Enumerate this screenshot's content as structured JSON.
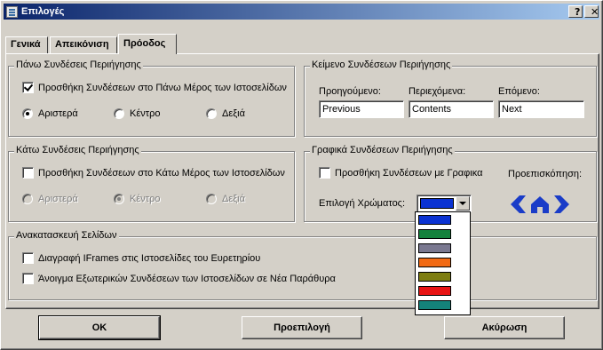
{
  "window": {
    "title": "Επιλογές",
    "help_label": "?",
    "close_label": "✕"
  },
  "tabs": [
    {
      "label": "Γενικά"
    },
    {
      "label": "Απεικόνιση"
    },
    {
      "label": "Πρόοδος",
      "active": true
    }
  ],
  "top_links": {
    "title": "Πάνω Συνδέσεις Περιήγησης",
    "add_label": "Προσθήκη Συνδέσεων στο Πάνω Μέρος των Ιστοσελίδων",
    "add_checked": true,
    "align_left": "Αριστερά",
    "align_center": "Κέντρο",
    "align_right": "Δεξιά",
    "selected": "Αριστερά"
  },
  "link_text": {
    "title": "Κείμενο Συνδέσεων Περιήγησης",
    "prev_label": "Προηγούμενο:",
    "contents_label": "Περιεχόμενα:",
    "next_label": "Επόμενο:",
    "prev_value": "Previous",
    "contents_value": "Contents",
    "next_value": "Next"
  },
  "bottom_links": {
    "title": "Κάτω Συνδέσεις Περιήγησης",
    "add_label": "Προσθήκη Συνδέσεων στο Κάτω Μέρος των Ιστοσελίδων",
    "add_checked": false,
    "align_left": "Αριστερά",
    "align_center": "Κέντρο",
    "align_right": "Δεξιά",
    "selected": "Κέντρο",
    "disabled": true
  },
  "graphic_links": {
    "title": "Γραφικά Συνδέσεων Περιήγησης",
    "add_label": "Προσθήκη Συνδέσεων με Γραφικα",
    "add_checked": false,
    "preview_label": "Προεπισκόπηση:",
    "color_label": "Επιλογή Χρώματος:",
    "selected_color": "#0a32d2",
    "color_options": [
      "#0a32d2",
      "#14823c",
      "#7a7890",
      "#f26a14",
      "#7d7d10",
      "#e81414",
      "#14827a"
    ],
    "preview_icon_color": "#1a3cc8"
  },
  "rebuild": {
    "title": "Ανακατασκευή Σελίδων",
    "opt1_label": "Διαγραφή IFrames στις Ιστοσελίδες του Ευρετηρίου",
    "opt1_checked": false,
    "opt2_label": "Άνοιγμα Εξωτερικών Συνδέσεων των Ιστοσελίδων σε Νέα Παράθυρα",
    "opt2_checked": false
  },
  "buttons": {
    "ok_label": "OK",
    "default_label": "Προεπιλογή",
    "cancel_label": "Ακύρωση"
  }
}
